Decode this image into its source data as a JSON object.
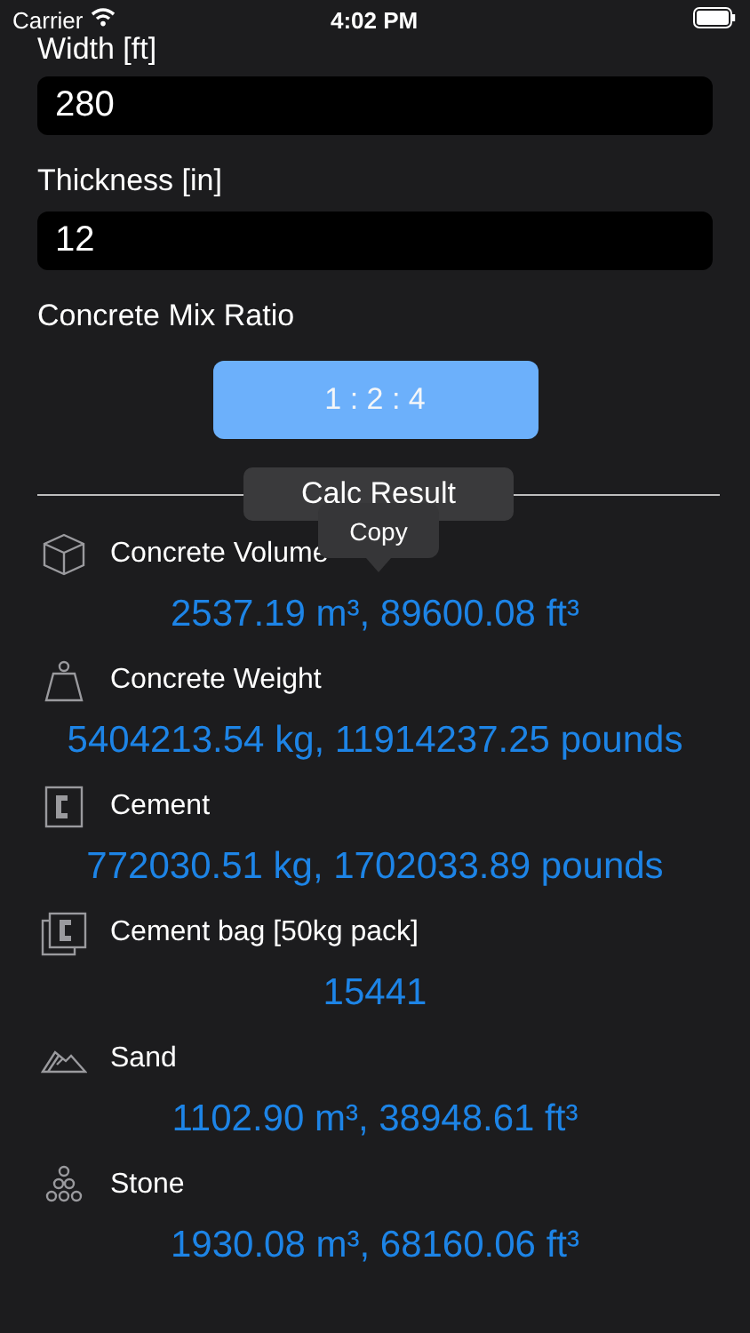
{
  "status_bar": {
    "carrier": "Carrier",
    "time": "4:02 PM"
  },
  "fields": [
    {
      "label": "Width [ft]",
      "value": "280"
    },
    {
      "label": "Thickness [in]",
      "value": "12"
    }
  ],
  "mix_ratio": {
    "label": "Concrete Mix Ratio",
    "button": "1 : 2 : 4"
  },
  "section_title": "Calc Result",
  "tooltip": "Copy",
  "results": [
    {
      "kind": "cube",
      "label": "Concrete Volume",
      "value": "2537.19 m³, 89600.08 ft³"
    },
    {
      "kind": "weight",
      "label": "Concrete Weight",
      "value": "5404213.54 kg, 11914237.25 pounds"
    },
    {
      "kind": "cement",
      "label": "Cement",
      "value": "772030.51 kg, 1702033.89 pounds"
    },
    {
      "kind": "bag",
      "label": "Cement bag [50kg pack]",
      "value": "15441"
    },
    {
      "kind": "sand",
      "label": "Sand",
      "value": "1102.90 m³, 38948.61 ft³"
    },
    {
      "kind": "stone",
      "label": "Stone",
      "value": "1930.08 m³, 68160.06 ft³"
    }
  ]
}
